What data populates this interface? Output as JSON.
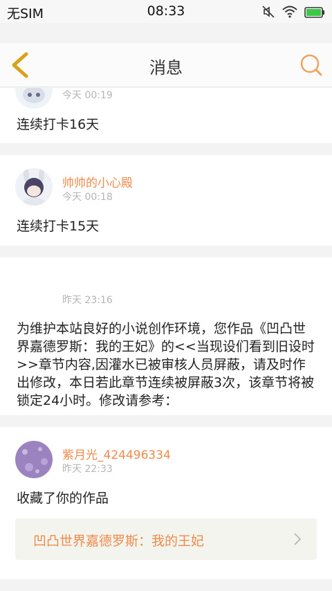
{
  "status_bar": {
    "carrier": "无SIM",
    "time": "08:33",
    "icons": [
      "mute-icon",
      "wifi-icon",
      "battery-icon"
    ]
  },
  "header": {
    "title": "消息",
    "back_icon": "chevron-left-icon",
    "search_icon": "search-icon"
  },
  "colors": {
    "accent": "#f08a4b",
    "back_icon": "#d8a21c",
    "muted_text": "#b5b5b5",
    "background": "#f3f3f3"
  },
  "messages": [
    {
      "user": "",
      "time": "今天 00:19",
      "content": "连续打卡16天"
    },
    {
      "user": "帅帅的小心殿",
      "time": "今天 00:18",
      "content": "连续打卡15天"
    },
    {
      "user": "",
      "time": "昨天 23:16",
      "content": "为维护本站良好的小说创作环境，您作品《凹凸世界嘉德罗斯：我的王妃》的<<当现设们看到旧设时>>章节内容,因灌水已被审核人员屏蔽，请及时作出修改，本日若此章节连续被屏蔽3次，该章节将被锁定24小时。修改请参考："
    },
    {
      "user": "紫月光_424496334",
      "time": "昨天 22:33",
      "content": "收藏了你的作品",
      "work_title": "凹凸世界嘉德罗斯：我的王妃"
    }
  ]
}
